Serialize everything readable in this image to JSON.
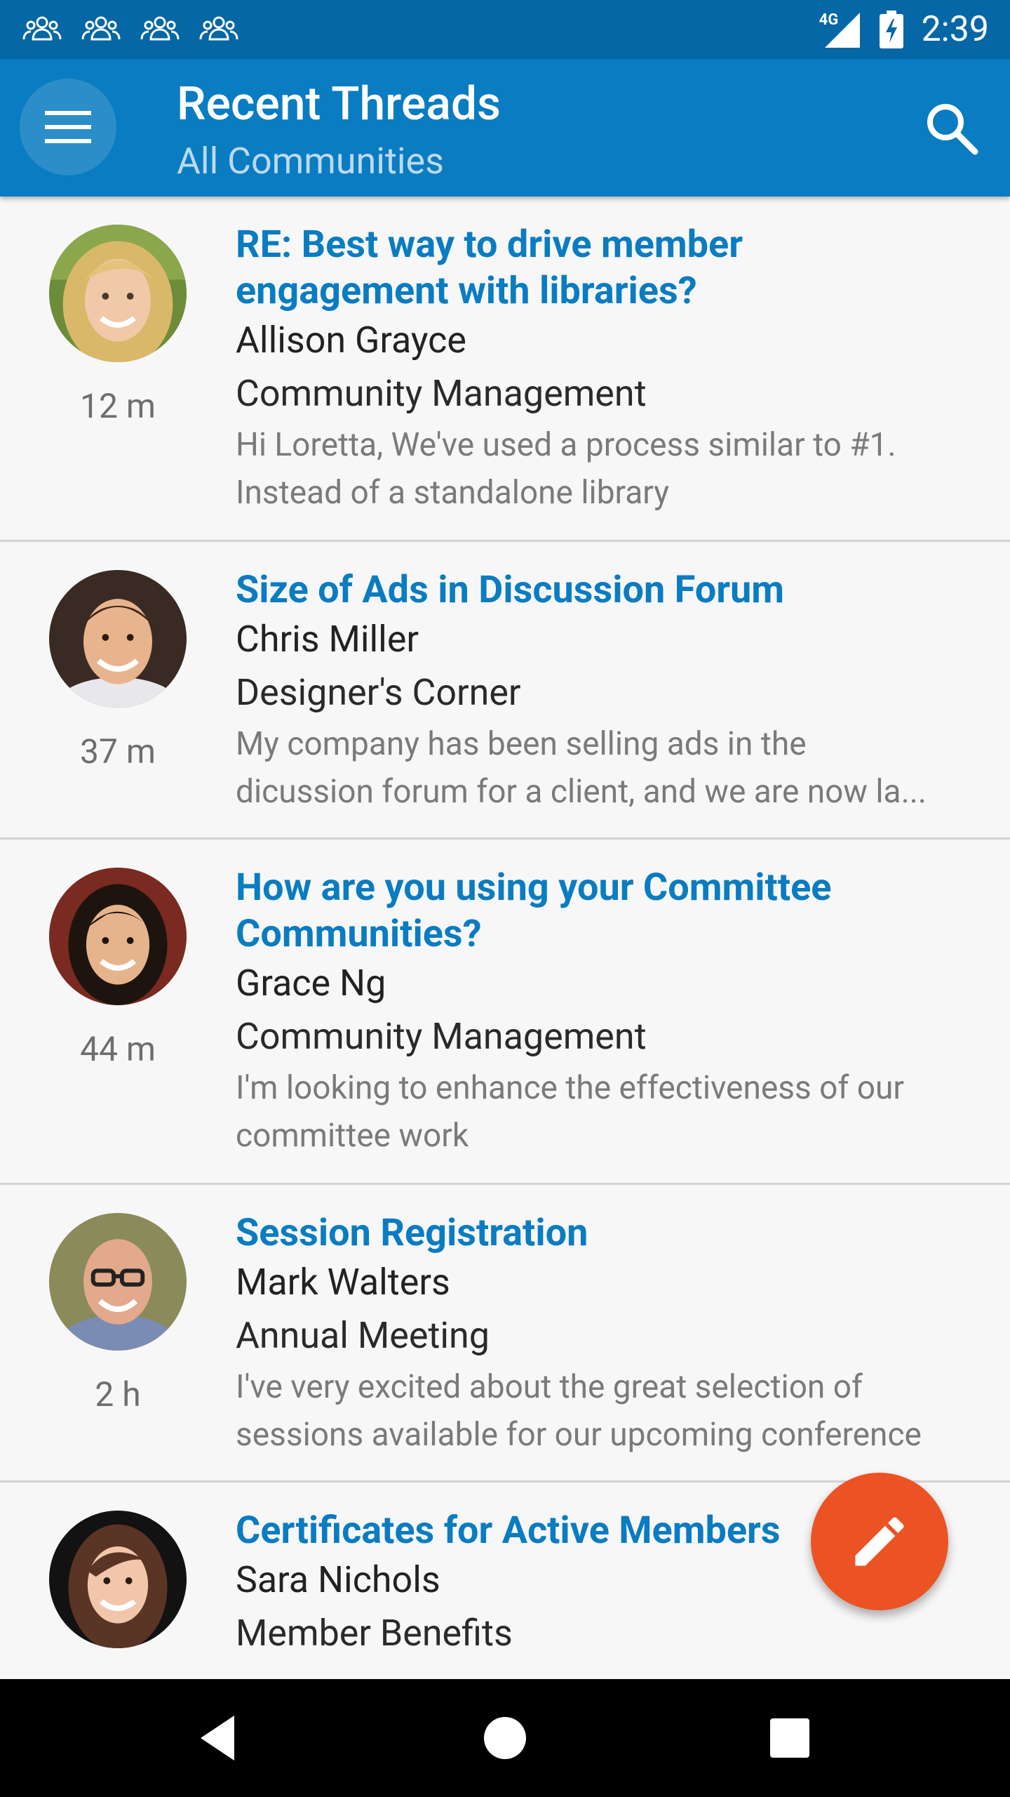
{
  "status_bar": {
    "time": "2:39",
    "network": "4G",
    "notification_icons": [
      "community-icon",
      "community-icon",
      "community-icon",
      "community-icon"
    ]
  },
  "app_bar": {
    "title": "Recent Threads",
    "subtitle": "All Communities",
    "menu_icon": "hamburger-menu-icon",
    "search_icon": "search-icon"
  },
  "colors": {
    "app_bar": "#0a7cc1",
    "status_bar": "#0567a5",
    "thread_title": "#0a7cc1",
    "fab": "#ec5324"
  },
  "threads": [
    {
      "title": "RE: Best way to drive member engagement with libraries?",
      "author": "Allison Grayce",
      "community": "Community Management",
      "snippet": "Hi Loretta, We've used a process similar to #1. Instead of a standalone library",
      "time": "12 m"
    },
    {
      "title": "Size of Ads in Discussion Forum",
      "author": "Chris Miller",
      "community": "Designer's Corner",
      "snippet_line1": "My company has been selling ads in the",
      "snippet_line2": "dicussion forum for a client, and we are now la...",
      "time": "37 m"
    },
    {
      "title": "How are you using your Committee Communities?",
      "author": "Grace Ng",
      "community": "Community Management",
      "snippet": "I'm looking to enhance the effectiveness of our committee work",
      "time": "44 m"
    },
    {
      "title": "Session Registration",
      "author": "Mark Walters",
      "community": "Annual Meeting",
      "snippet": "I've very excited about the great selection of sessions available for our upcoming conference",
      "time": "2 h"
    },
    {
      "title": "Certificates for Active Members",
      "author": "Sara Nichols",
      "community": "Member Benefits",
      "snippet": "",
      "time": ""
    }
  ],
  "fab": {
    "icon": "pencil-icon"
  },
  "nav_bar": {
    "icons": [
      "back-icon",
      "home-icon",
      "recents-icon"
    ]
  }
}
